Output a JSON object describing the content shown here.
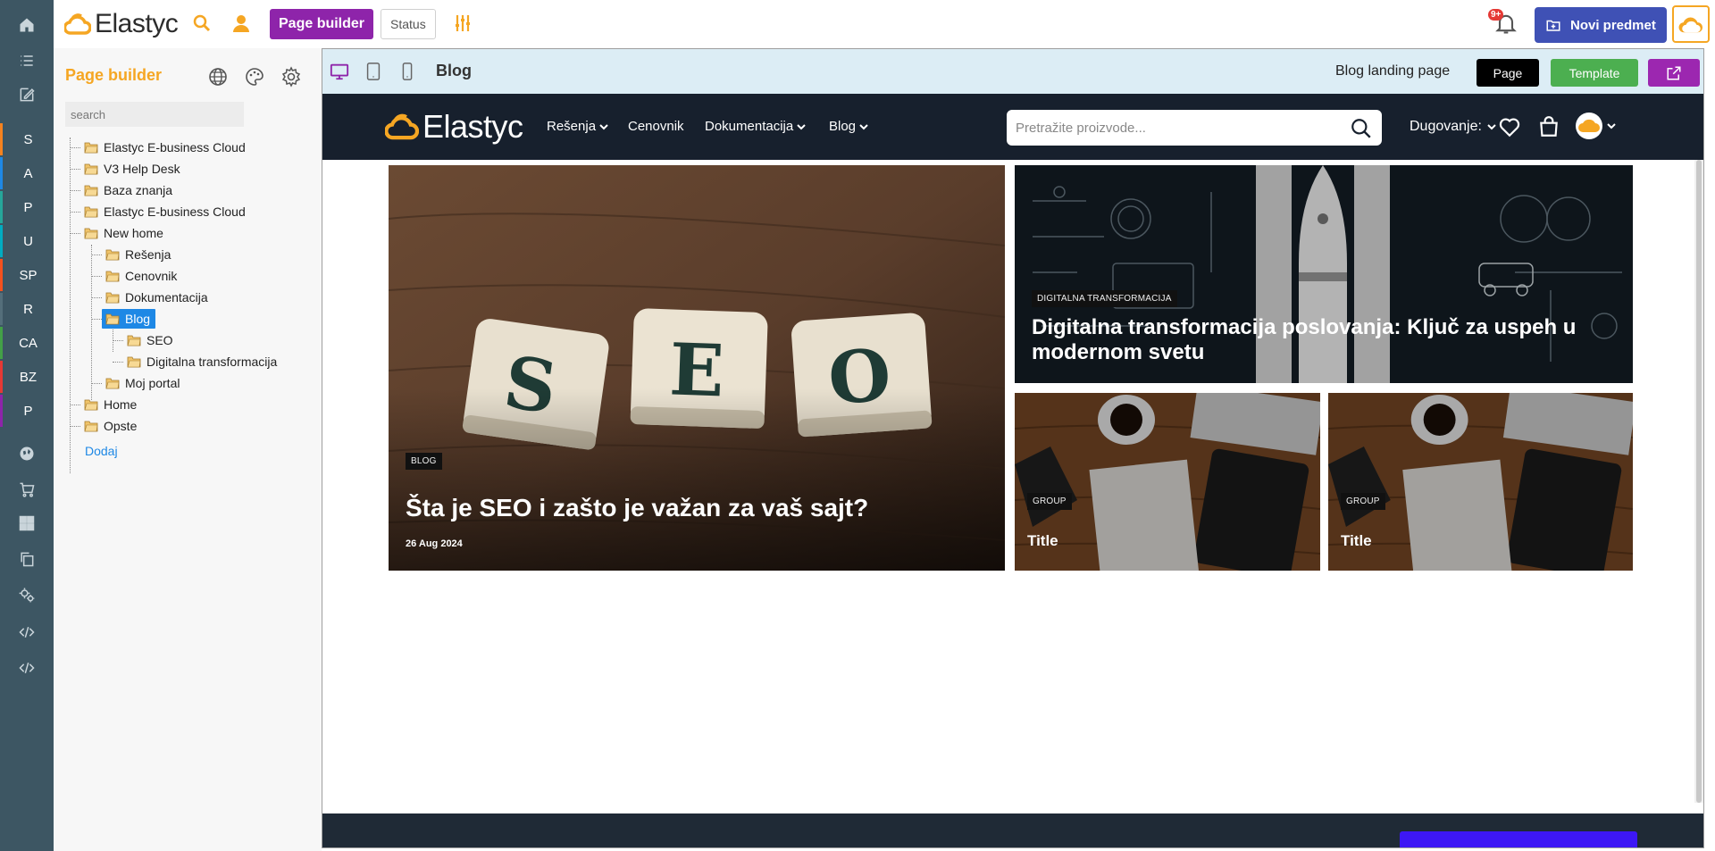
{
  "rail": {
    "letters": [
      {
        "label": "S",
        "color": "#f5821f"
      },
      {
        "label": "A",
        "color": "#1e88e5"
      },
      {
        "label": "P",
        "color": "#26a69a"
      },
      {
        "label": "U",
        "color": "#00acc1"
      },
      {
        "label": "SP",
        "color": "#f4511e"
      },
      {
        "label": "R",
        "color": "#546e7a"
      },
      {
        "label": "CA",
        "color": "#43a047"
      },
      {
        "label": "BZ",
        "color": "#e53935"
      },
      {
        "label": "P",
        "color": "#8e24aa"
      }
    ]
  },
  "topbar": {
    "logo": "Elastyc",
    "page_builder_label": "Page builder",
    "status_label": "Status",
    "notification_badge": "9+",
    "new_item_label": "Novi predmet"
  },
  "sidebar": {
    "title": "Page builder",
    "search_placeholder": "search",
    "tree": [
      {
        "label": "Elastyc E-business Cloud"
      },
      {
        "label": "V3 Help Desk"
      },
      {
        "label": "Baza znanja"
      },
      {
        "label": "Elastyc E-business Cloud"
      },
      {
        "label": "New home"
      },
      {
        "label": "Rešenja"
      },
      {
        "label": "Cenovnik"
      },
      {
        "label": "Dokumentacija"
      },
      {
        "label": "Blog"
      },
      {
        "label": "SEO"
      },
      {
        "label": "Digitalna transformacija"
      },
      {
        "label": "Moj portal"
      },
      {
        "label": "Home"
      },
      {
        "label": "Opste"
      }
    ],
    "add_label": "Dodaj"
  },
  "editor": {
    "title": "Blog",
    "page_name": "Blog landing page",
    "page_button": "Page",
    "template_button": "Template"
  },
  "site": {
    "logo": "Elastyc",
    "nav": {
      "resenja": "Rešenja",
      "cenovnik": "Cenovnik",
      "dokumentacija": "Dokumentacija",
      "blog": "Blog"
    },
    "search_placeholder": "Pretražite proizvode...",
    "dugovanje": "Dugovanje:",
    "cards": {
      "main": {
        "tag": "BLOG",
        "title": "Šta je SEO i zašto je važan za vaš sajt?",
        "date": "26 Aug 2024"
      },
      "top_right": {
        "tag": "DIGITALNA TRANSFORMACIJA",
        "title": "Digitalna transformacija poslovanja: Ključ za uspeh u modernom svetu"
      },
      "bottom_left": {
        "tag": "GROUP",
        "title": "Title"
      },
      "bottom_right": {
        "tag": "GROUP",
        "title": "Title"
      }
    }
  },
  "colors": {
    "accent": "#f5a623",
    "purple": "#8e24aa",
    "indigo": "#3f51b5",
    "green": "#4caf50",
    "site_header": "#17202d"
  }
}
